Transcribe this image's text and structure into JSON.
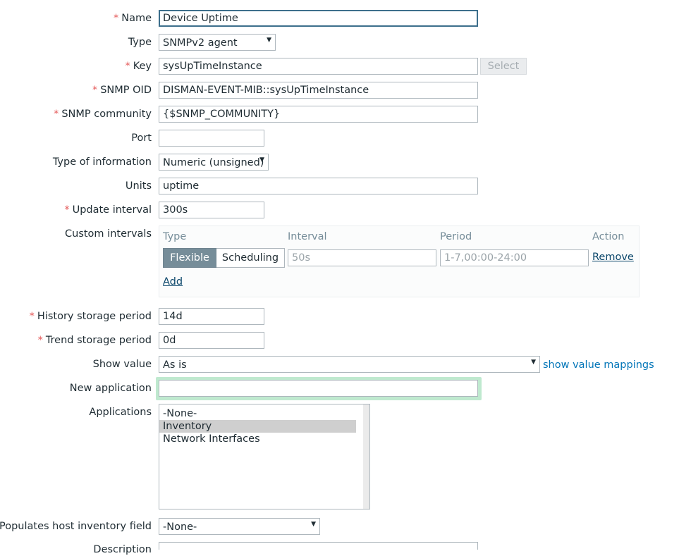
{
  "form": {
    "name": {
      "label": "Name",
      "required": "*",
      "value": "Device Uptime"
    },
    "type": {
      "label": "Type",
      "value": "SNMPv2 agent"
    },
    "key": {
      "label": "Key",
      "required": "*",
      "value": "sysUpTimeInstance",
      "select_button": "Select"
    },
    "snmp_oid": {
      "label": "SNMP OID",
      "required": "*",
      "value": "DISMAN-EVENT-MIB::sysUpTimeInstance"
    },
    "snmp_community": {
      "label": "SNMP community",
      "required": "*",
      "value": "{$SNMP_COMMUNITY}"
    },
    "port": {
      "label": "Port",
      "value": ""
    },
    "type_of_information": {
      "label": "Type of information",
      "value": "Numeric (unsigned)"
    },
    "units": {
      "label": "Units",
      "value": "uptime"
    },
    "update_interval": {
      "label": "Update interval",
      "required": "*",
      "value": "300s"
    },
    "custom_intervals": {
      "label": "Custom intervals",
      "headers": {
        "type": "Type",
        "interval": "Interval",
        "period": "Period",
        "action": "Action"
      },
      "row": {
        "flexible": "Flexible",
        "scheduling": "Scheduling",
        "interval_placeholder": "50s",
        "period_placeholder": "1-7,00:00-24:00",
        "remove": "Remove"
      },
      "add": "Add"
    },
    "history_storage": {
      "label": "History storage period",
      "required": "*",
      "value": "14d"
    },
    "trend_storage": {
      "label": "Trend storage period",
      "required": "*",
      "value": "0d"
    },
    "show_value": {
      "label": "Show value",
      "value": "As is",
      "link": "show value mappings"
    },
    "new_application": {
      "label": "New application",
      "value": ""
    },
    "applications": {
      "label": "Applications",
      "options": [
        "-None-",
        "Inventory",
        "Network Interfaces"
      ],
      "selected": "Inventory"
    },
    "inventory_field": {
      "label": "Populates host inventory field",
      "value": "-None-"
    },
    "description": {
      "label": "Description"
    }
  },
  "colors": {
    "required": "#e45959",
    "link": "#0275b8",
    "segment_active": "#768d99",
    "focus_glow": "#bfe9cf"
  }
}
